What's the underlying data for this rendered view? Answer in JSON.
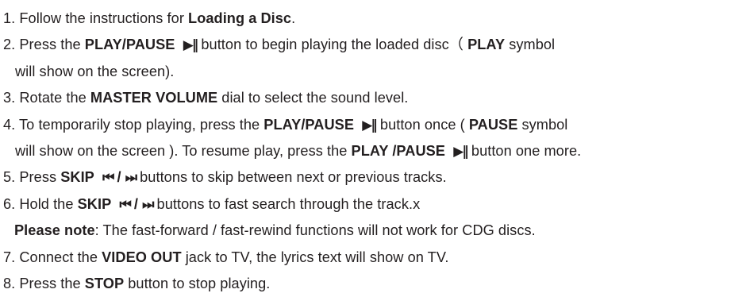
{
  "instructions": {
    "line1": {
      "a": "1. Follow the instructions for ",
      "b": "Loading a Disc",
      "c": "."
    },
    "line2": {
      "a": "2. Press the ",
      "b": "PLAY/PAUSE",
      "icon": "▶‖",
      "c": " button to begin playing the loaded disc（ ",
      "d": "PLAY",
      "e": " symbol"
    },
    "line3": {
      "a": "will show on the screen)."
    },
    "line4": {
      "a": "3. Rotate the ",
      "b": "MASTER VOLUME",
      "c": " dial to select the sound level."
    },
    "line5": {
      "a": "4. To temporarily stop playing, press the ",
      "b": "PLAY/PAUSE",
      "icon": "▶‖",
      "c": "  button once ( ",
      "d": "PAUSE",
      "e": " symbol"
    },
    "line6": {
      "a": "will show on the screen ). To resume play, press the ",
      "b": "PLAY /PAUSE",
      "icon": "▶‖",
      "c": " button one more."
    },
    "line7": {
      "a": "5. Press ",
      "b": "SKIP",
      "icon_prev": "⏮",
      "sep": " / ",
      "icon_next": "⏭",
      "c": " buttons to skip between next or previous tracks."
    },
    "line8": {
      "a": "6. Hold the ",
      "b": "SKIP",
      "icon_prev": "⏮",
      "sep": " / ",
      "icon_next": "⏭",
      "c": " buttons to fast search through the track.x"
    },
    "line9": {
      "a": "Please note",
      "b": ": The fast-forward / fast-rewind functions will not work for CDG discs."
    },
    "line10": {
      "a": "7. Connect the ",
      "b": "VIDEO OUT",
      "c": " jack to TV, the lyrics text will show on TV."
    },
    "line11": {
      "a": "8. Press the ",
      "b": "STOP",
      "c": " button to stop playing."
    }
  }
}
